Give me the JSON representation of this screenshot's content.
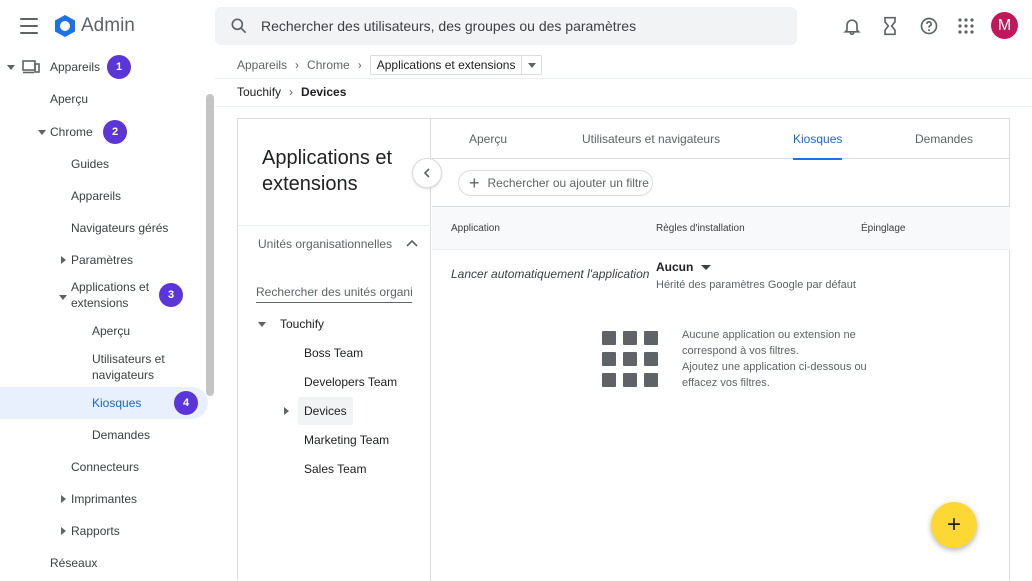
{
  "app": {
    "title": "Admin",
    "avatar_letter": "M",
    "avatar_color": "#c2185b"
  },
  "search": {
    "placeholder": "Rechercher des utilisateurs, des groupes ou des paramètres"
  },
  "sidebar": {
    "items": [
      {
        "label": "Appareils",
        "badge": "1"
      },
      {
        "label": "Aperçu"
      },
      {
        "label": "Chrome",
        "badge": "2"
      },
      {
        "label": "Guides"
      },
      {
        "label": "Appareils"
      },
      {
        "label": "Navigateurs gérés"
      },
      {
        "label": "Paramètres"
      },
      {
        "label": "Applications et extensions",
        "badge": "3"
      },
      {
        "label": "Aperçu"
      },
      {
        "label": "Utilisateurs et navigateurs"
      },
      {
        "label": "Kiosques",
        "badge": "4"
      },
      {
        "label": "Demandes"
      },
      {
        "label": "Connecteurs"
      },
      {
        "label": "Imprimantes"
      },
      {
        "label": "Rapports"
      },
      {
        "label": "Réseaux"
      }
    ],
    "badge_color": "#5c35d9"
  },
  "breadcrumb": {
    "items": [
      "Appareils",
      "Chrome"
    ],
    "current": "Applications et extensions",
    "ou_path": [
      "Touchify",
      "Devices"
    ]
  },
  "left_panel": {
    "title": "Applications et extensions",
    "ou_header": "Unités organisationnelles",
    "ou_search_placeholder": "Rechercher des unités organisationnelles",
    "tree": [
      "Touchify",
      "Boss Team",
      "Developers Team",
      "Devices",
      "Marketing Team",
      "Sales Team"
    ]
  },
  "tabs": [
    "Aperçu",
    "Utilisateurs et navigateurs",
    "Kiosques",
    "Demandes"
  ],
  "filter": {
    "label": "Rechercher ou ajouter un filtre"
  },
  "table": {
    "headers": [
      "Application",
      "Règles d'installation",
      "Épinglage"
    ],
    "row": {
      "app": "Lancer automatiquement l'application",
      "rule": "Aucun",
      "inherit": "Hérité des paramètres Google par défaut"
    }
  },
  "empty": {
    "line1": "Aucune application ou extension ne correspond à vos filtres.",
    "line2": "Ajoutez une application ci-dessous ou effacez vos filtres."
  },
  "fab": {
    "symbol": "+"
  }
}
